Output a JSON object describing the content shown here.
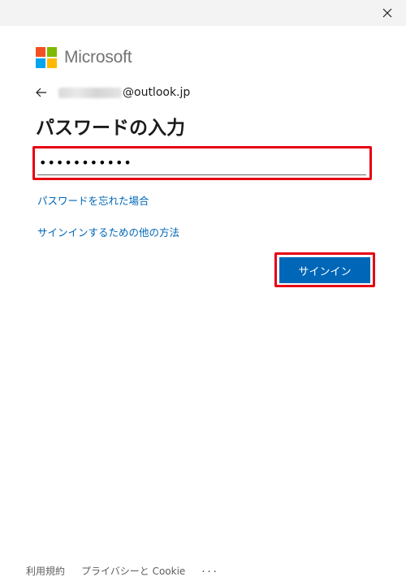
{
  "window": {
    "close_icon": "close-icon"
  },
  "brand": {
    "name": "Microsoft",
    "colors": [
      "#f25022",
      "#7fba00",
      "#00a4ef",
      "#ffb900"
    ]
  },
  "identity": {
    "back_icon": "arrow-left-icon",
    "email_domain": "@outlook.jp"
  },
  "page": {
    "heading": "パスワードの入力"
  },
  "password": {
    "value": "•••••••••••"
  },
  "links": {
    "forgot_password": "パスワードを忘れた場合",
    "other_ways": "サインインするための他の方法"
  },
  "buttons": {
    "sign_in": "サインイン"
  },
  "footer": {
    "terms": "利用規約",
    "privacy": "プライバシーと Cookie",
    "more": "..."
  },
  "colors": {
    "accent": "#0067b8",
    "highlight": "#e60012"
  }
}
